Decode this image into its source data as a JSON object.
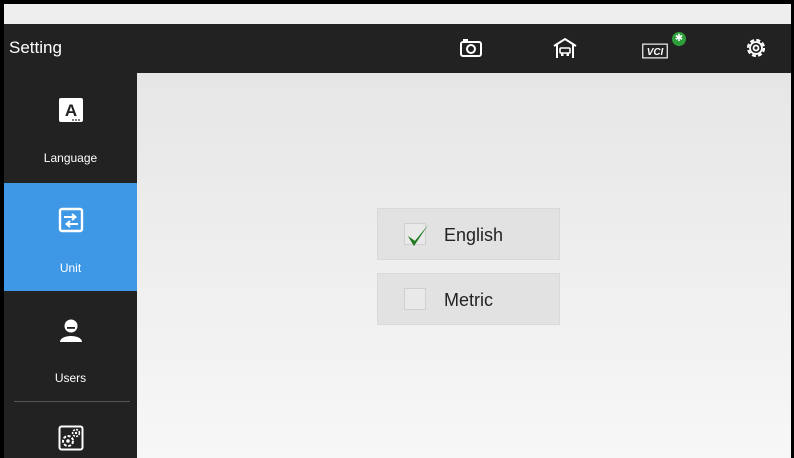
{
  "header": {
    "title": "Setting",
    "icons": [
      "camera-icon",
      "garage-icon",
      "vci-icon",
      "bluetooth-icon",
      "settings-icon"
    ],
    "vci_label": "VCI"
  },
  "sidebar": {
    "items": [
      {
        "label": "Language",
        "icon": "language-icon",
        "active": false
      },
      {
        "label": "Unit",
        "icon": "unit-icon",
        "active": true
      },
      {
        "label": "Users",
        "icon": "user-icon",
        "active": false
      },
      {
        "label": "",
        "icon": "system-settings-icon",
        "active": false
      }
    ]
  },
  "main": {
    "options": [
      {
        "label": "English",
        "checked": true
      },
      {
        "label": "Metric",
        "checked": false
      }
    ]
  },
  "colors": {
    "topbar": "#222222",
    "sidebar": "#222222",
    "active_item": "#3e98e6",
    "checkmark": "#1f7a1f",
    "bluetooth_badge": "#2e9e3a"
  }
}
